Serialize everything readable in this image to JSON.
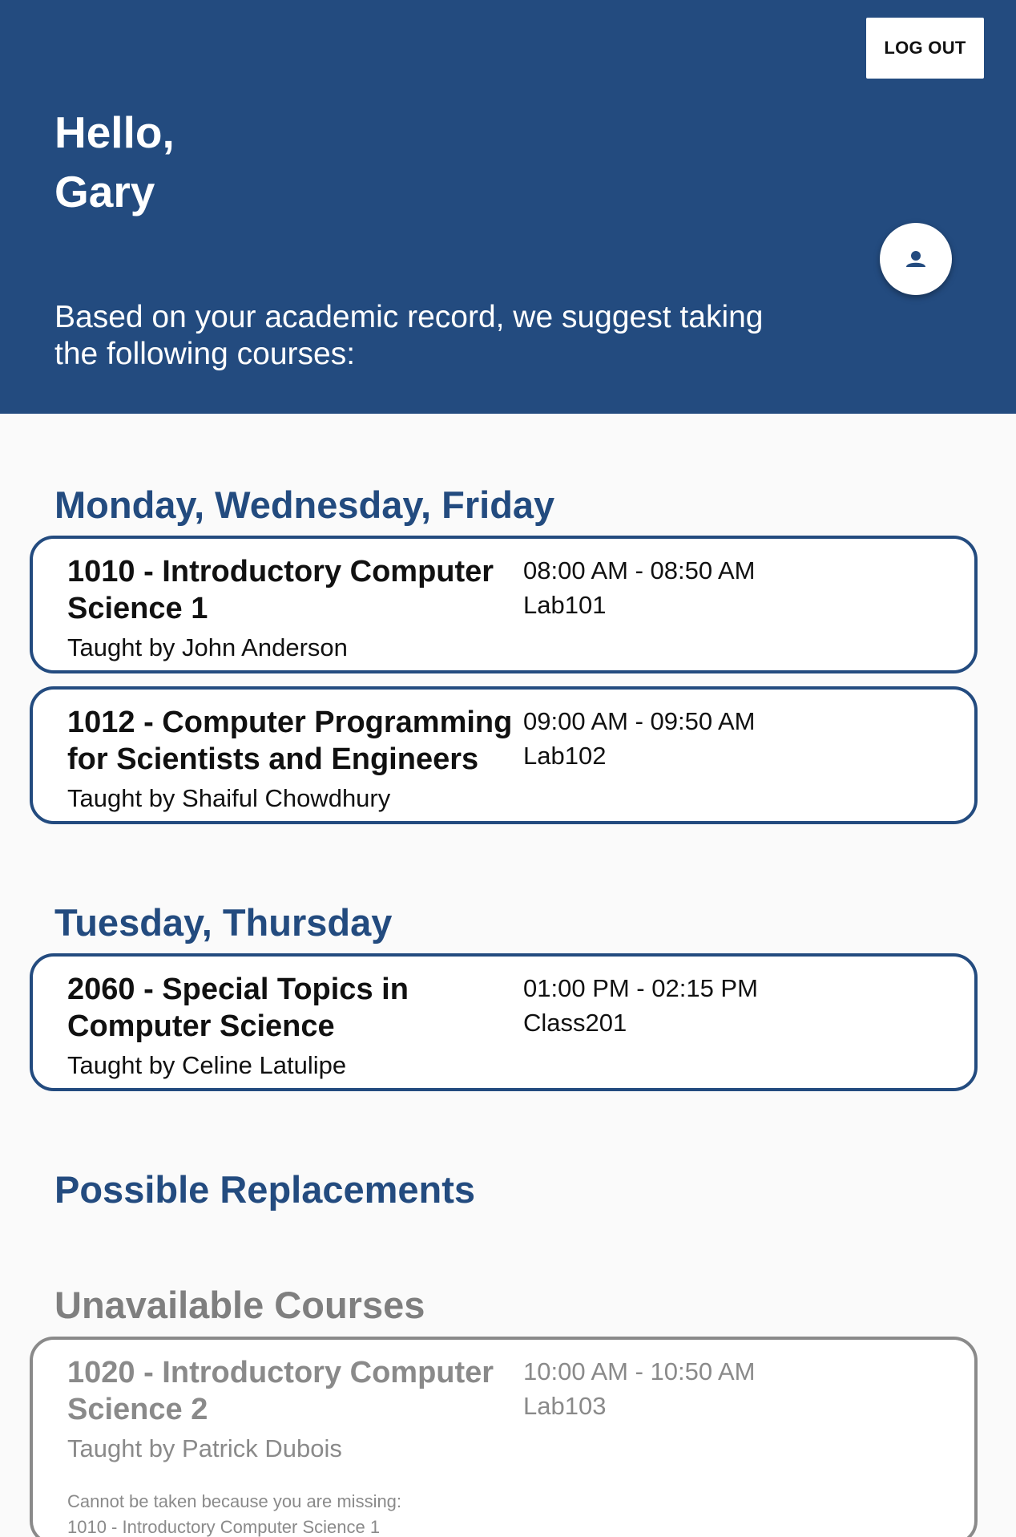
{
  "header": {
    "logout_label": "LOG OUT",
    "greeting_line1": "Hello,",
    "greeting_line2": "Gary",
    "suggestion": "Based on your academic record, we suggest taking the following courses:",
    "avatar_icon": "person-icon",
    "bg_color": "#234b7f"
  },
  "sections": {
    "mwf": {
      "title": "Monday, Wednesday, Friday",
      "courses": [
        {
          "title": "1010 - Introductory Computer Science 1",
          "teacher": "Taught by John Anderson",
          "time": "08:00 AM - 08:50 AM",
          "room": "Lab101"
        },
        {
          "title": "1012 - Computer Programming for Scientists and Engineers",
          "teacher": "Taught by Shaiful Chowdhury",
          "time": "09:00 AM - 09:50 AM",
          "room": "Lab102"
        }
      ]
    },
    "tt": {
      "title": "Tuesday, Thursday",
      "courses": [
        {
          "title": "2060 - Special Topics in Computer Science",
          "teacher": "Taught by Celine Latulipe",
          "time": "01:00 PM - 02:15 PM",
          "room": "Class201"
        }
      ]
    },
    "replacements": {
      "title": "Possible Replacements"
    },
    "unavailable": {
      "title": "Unavailable Courses",
      "courses": [
        {
          "title": "1020 - Introductory Computer Science 2",
          "teacher": "Taught by Patrick Dubois",
          "time": "10:00 AM - 10:50 AM",
          "room": "Lab103",
          "missing_label": "Cannot be taken because you are missing:",
          "missing_course": "1010 - Introductory Computer Science 1"
        }
      ]
    }
  },
  "colors": {
    "accent": "#234b7f",
    "muted": "#8a8a8a",
    "background": "#fafafa"
  }
}
